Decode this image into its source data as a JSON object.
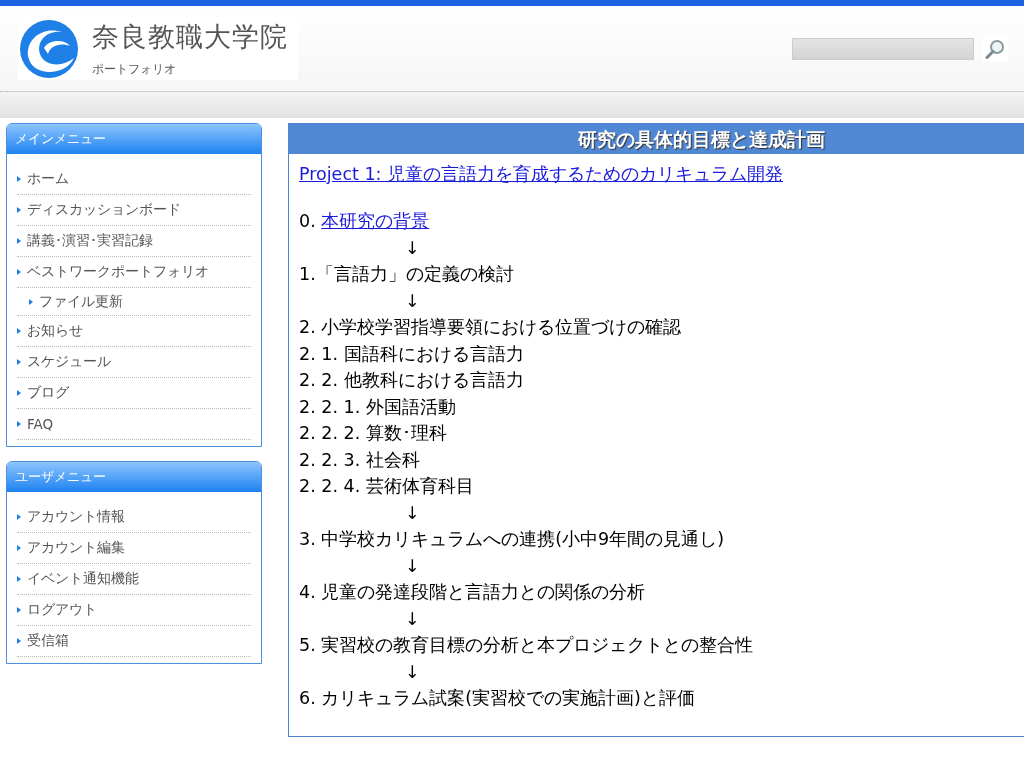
{
  "header": {
    "site_title": "奈良教職大学院",
    "site_subtitle": "ポートフォリオ"
  },
  "sidebar": [
    {
      "title": "メインメニュー",
      "items": [
        {
          "label": "ホーム"
        },
        {
          "label": "ディスカッションボード"
        },
        {
          "label": "講義･演習･実習記録"
        },
        {
          "label": "ベストワークポートフォリオ",
          "children": [
            {
              "label": "ファイル更新"
            }
          ]
        },
        {
          "label": "お知らせ"
        },
        {
          "label": "スケジュール"
        },
        {
          "label": "ブログ"
        },
        {
          "label": "FAQ"
        }
      ]
    },
    {
      "title": "ユーザメニュー",
      "items": [
        {
          "label": "アカウント情報"
        },
        {
          "label": "アカウント編集"
        },
        {
          "label": "イベント通知機能"
        },
        {
          "label": "ログアウト"
        },
        {
          "label": "受信箱"
        }
      ]
    }
  ],
  "main": {
    "title": "研究の具体的目標と達成計画",
    "project_link": "Project 1:  児童の言語力を育成するためのカリキュラム開発",
    "lines": [
      {
        "kind": "link-step",
        "prefix": "0. ",
        "link": "本研究の背景"
      },
      {
        "kind": "arrow",
        "text": "↓"
      },
      {
        "kind": "step",
        "text": "1.「言語力」の定義の検討"
      },
      {
        "kind": "arrow",
        "text": "↓"
      },
      {
        "kind": "step",
        "text": "2. 小学校学習指導要領における位置づけの確認"
      },
      {
        "kind": "step",
        "text": "2. 1. 国語科における言語力"
      },
      {
        "kind": "step",
        "text": "2. 2. 他教科における言語力"
      },
      {
        "kind": "step",
        "text": "2. 2. 1. 外国語活動"
      },
      {
        "kind": "step",
        "text": "2. 2. 2. 算数･理科"
      },
      {
        "kind": "step",
        "text": "2. 2. 3. 社会科"
      },
      {
        "kind": "step",
        "text": "2. 2. 4. 芸術体育科目"
      },
      {
        "kind": "arrow",
        "text": "↓"
      },
      {
        "kind": "step",
        "text": "3. 中学校カリキュラムへの連携(小中9年間の見通し)"
      },
      {
        "kind": "arrow",
        "text": "↓"
      },
      {
        "kind": "step",
        "text": "4. 児童の発達段階と言語力との関係の分析"
      },
      {
        "kind": "arrow",
        "text": "↓"
      },
      {
        "kind": "step",
        "text": "5. 実習校の教育目標の分析と本プロジェクトとの整合性"
      },
      {
        "kind": "arrow",
        "text": "↓"
      },
      {
        "kind": "step",
        "text": "6. カリキュラム試案(実習校での実施計画)と評価"
      }
    ]
  }
}
